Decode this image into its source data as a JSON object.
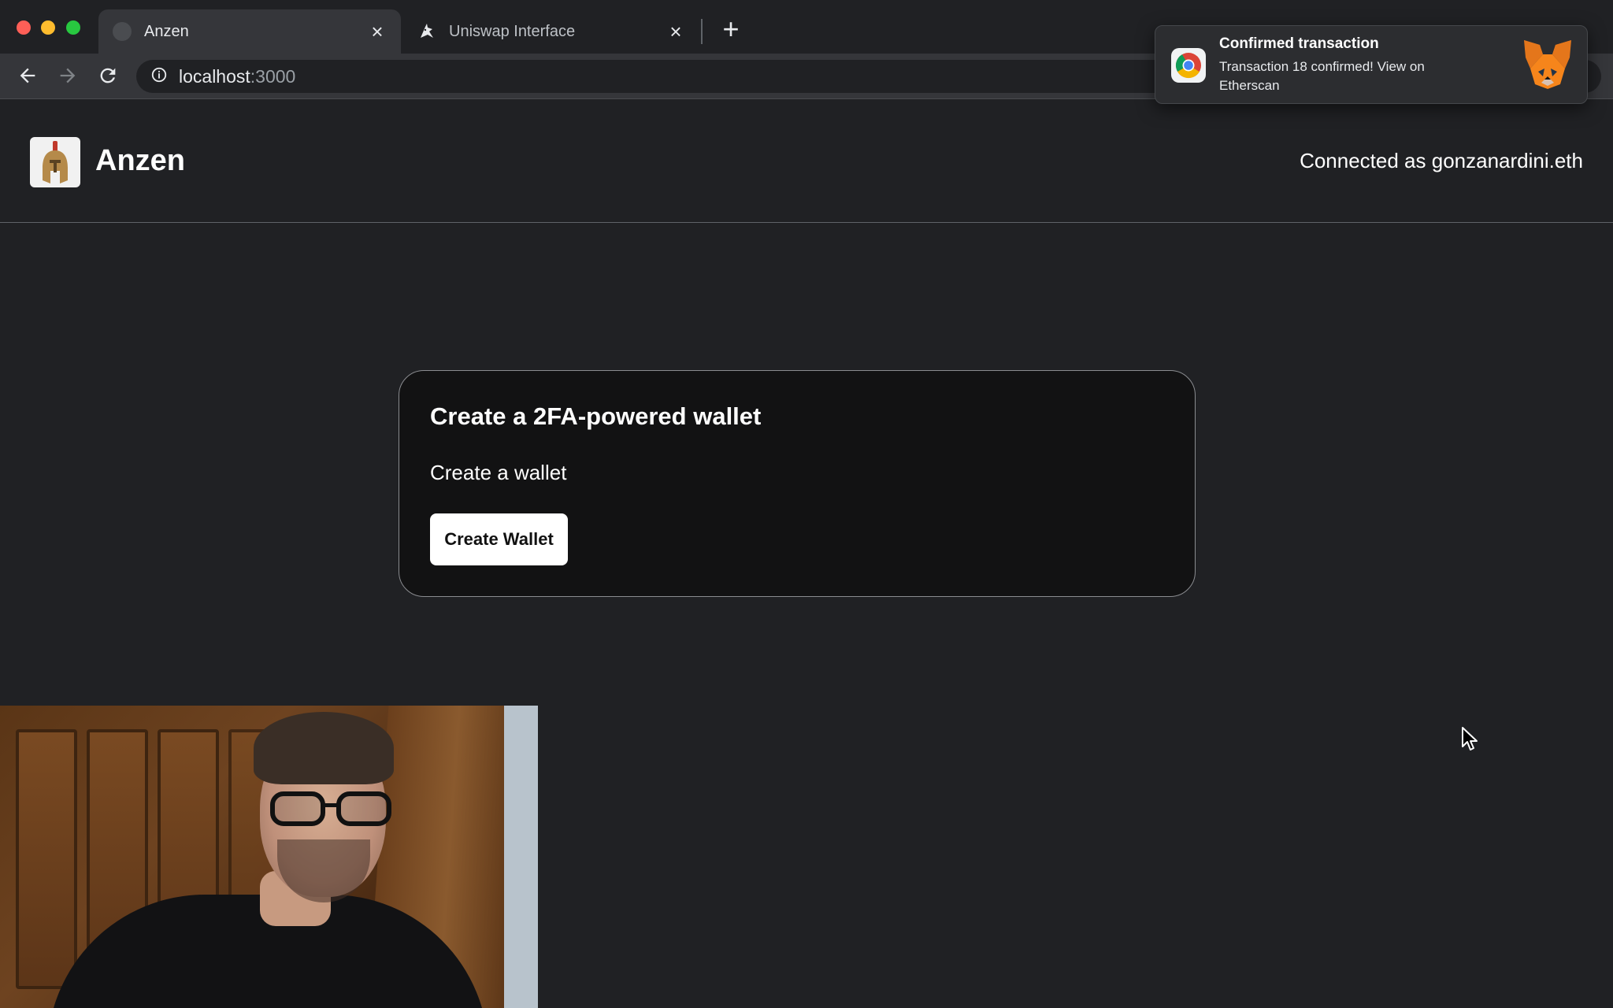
{
  "browser": {
    "tabs": [
      {
        "title": "Anzen",
        "active": true,
        "favicon": "anzen-favicon-icon"
      },
      {
        "title": "Uniswap Interface",
        "active": false,
        "favicon": "unicorn-icon"
      }
    ],
    "close_glyph": "×",
    "newtab_glyph": "+",
    "address": {
      "host": "localhost",
      "port": ":3000"
    }
  },
  "notification": {
    "title": "Confirmed transaction",
    "body": "Transaction 18 confirmed! View on Etherscan",
    "app_icon": "chrome-icon",
    "image": "metamask-fox-icon"
  },
  "app": {
    "brand": "Anzen",
    "connected": "Connected as gonzanardini.eth",
    "logo": "spartan-helmet-icon"
  },
  "card": {
    "title": "Create a 2FA-powered wallet",
    "subtitle": "Create a wallet",
    "button_label": "Create Wallet"
  },
  "colors": {
    "page_bg": "#202124",
    "card_bg": "#121213",
    "card_border": "#8a8c90",
    "button_bg": "#ffffff",
    "text": "#ffffff"
  }
}
